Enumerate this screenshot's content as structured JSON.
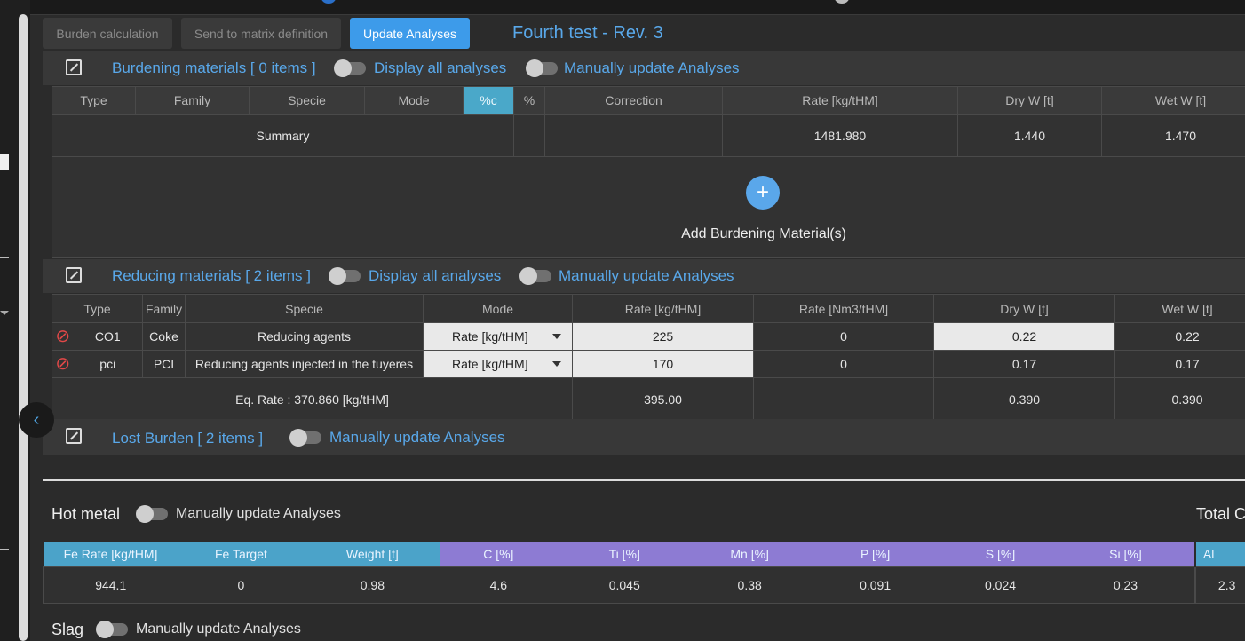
{
  "toolbar": {
    "burden_calc": "Burden calculation",
    "send_matrix": "Send to matrix definition",
    "update_analyses": "Update Analyses",
    "doc_title": "Fourth test - Rev. 3"
  },
  "burdening": {
    "title": "Burdening materials [ 0 items ]",
    "display_all": "Display all analyses",
    "manual_update": "Manually update Analyses",
    "columns": [
      "Type",
      "Family",
      "Specie",
      "Mode",
      "%c",
      "%",
      "Correction",
      "Rate [kg/tHM]",
      "Dry W [t]",
      "Wet W [t]"
    ],
    "summary": {
      "label": "Summary",
      "rate": "1481.980",
      "dry": "1.440",
      "wet": "1.470"
    },
    "add_label": "Add Burdening Material(s)"
  },
  "reducing": {
    "title": "Reducing materials [ 2 items ]",
    "display_all": "Display all analyses",
    "manual_update": "Manually update Analyses",
    "columns": [
      "Type",
      "Family",
      "Specie",
      "Mode",
      "Rate [kg/tHM]",
      "Rate [Nm3/tHM]",
      "Dry W [t]",
      "Wet W [t]"
    ],
    "rows": [
      {
        "type": "CO1",
        "family": "Coke",
        "specie": "Reducing agents",
        "mode": "Rate [kg/tHM]",
        "rate": "225",
        "rate_nm3": "0",
        "dry": "0.22",
        "wet": "0.22"
      },
      {
        "type": "pci",
        "family": "PCI",
        "specie": "Reducing agents injected in the tuyeres",
        "mode": "Rate [kg/tHM]",
        "rate": "170",
        "rate_nm3": "0",
        "dry": "0.17",
        "wet": "0.17"
      }
    ],
    "summary": {
      "eq_rate": "Eq. Rate : 370.860 [kg/tHM]",
      "rate": "395.00",
      "dry": "0.390",
      "wet": "0.390"
    }
  },
  "lost": {
    "title": "Lost Burden [ 2 items ]",
    "manual_update": "Manually update Analyses"
  },
  "hot_metal": {
    "title": "Hot metal",
    "manual_update": "Manually update Analyses",
    "total_label": "Total C",
    "columns": [
      "Fe Rate [kg/tHM]",
      "Fe Target",
      "Weight [t]",
      "C [%]",
      "Ti [%]",
      "Mn [%]",
      "P [%]",
      "S [%]",
      "Si [%]",
      "Al"
    ],
    "values": [
      "944.1",
      "0",
      "0.98",
      "4.6",
      "0.045",
      "0.38",
      "0.091",
      "0.024",
      "0.23",
      "2.3"
    ]
  },
  "slag": {
    "title": "Slag",
    "manual_update": "Manually update Analyses"
  },
  "colors": {
    "accent": "#59a8ea",
    "header_blue": "#4ba3c9",
    "header_purple": "#8d7bd3",
    "delete": "#e24848"
  }
}
